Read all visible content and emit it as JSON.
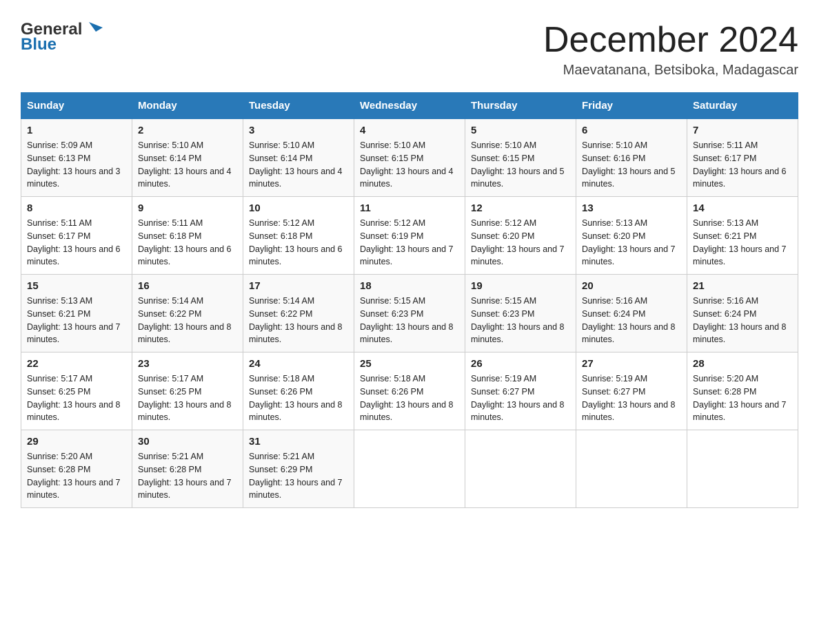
{
  "logo": {
    "text_general": "General",
    "text_blue": "Blue"
  },
  "title": "December 2024",
  "location": "Maevatanana, Betsiboka, Madagascar",
  "days_of_week": [
    "Sunday",
    "Monday",
    "Tuesday",
    "Wednesday",
    "Thursday",
    "Friday",
    "Saturday"
  ],
  "weeks": [
    [
      {
        "day": "1",
        "sunrise": "5:09 AM",
        "sunset": "6:13 PM",
        "daylight": "13 hours and 3 minutes."
      },
      {
        "day": "2",
        "sunrise": "5:10 AM",
        "sunset": "6:14 PM",
        "daylight": "13 hours and 4 minutes."
      },
      {
        "day": "3",
        "sunrise": "5:10 AM",
        "sunset": "6:14 PM",
        "daylight": "13 hours and 4 minutes."
      },
      {
        "day": "4",
        "sunrise": "5:10 AM",
        "sunset": "6:15 PM",
        "daylight": "13 hours and 4 minutes."
      },
      {
        "day": "5",
        "sunrise": "5:10 AM",
        "sunset": "6:15 PM",
        "daylight": "13 hours and 5 minutes."
      },
      {
        "day": "6",
        "sunrise": "5:10 AM",
        "sunset": "6:16 PM",
        "daylight": "13 hours and 5 minutes."
      },
      {
        "day": "7",
        "sunrise": "5:11 AM",
        "sunset": "6:17 PM",
        "daylight": "13 hours and 6 minutes."
      }
    ],
    [
      {
        "day": "8",
        "sunrise": "5:11 AM",
        "sunset": "6:17 PM",
        "daylight": "13 hours and 6 minutes."
      },
      {
        "day": "9",
        "sunrise": "5:11 AM",
        "sunset": "6:18 PM",
        "daylight": "13 hours and 6 minutes."
      },
      {
        "day": "10",
        "sunrise": "5:12 AM",
        "sunset": "6:18 PM",
        "daylight": "13 hours and 6 minutes."
      },
      {
        "day": "11",
        "sunrise": "5:12 AM",
        "sunset": "6:19 PM",
        "daylight": "13 hours and 7 minutes."
      },
      {
        "day": "12",
        "sunrise": "5:12 AM",
        "sunset": "6:20 PM",
        "daylight": "13 hours and 7 minutes."
      },
      {
        "day": "13",
        "sunrise": "5:13 AM",
        "sunset": "6:20 PM",
        "daylight": "13 hours and 7 minutes."
      },
      {
        "day": "14",
        "sunrise": "5:13 AM",
        "sunset": "6:21 PM",
        "daylight": "13 hours and 7 minutes."
      }
    ],
    [
      {
        "day": "15",
        "sunrise": "5:13 AM",
        "sunset": "6:21 PM",
        "daylight": "13 hours and 7 minutes."
      },
      {
        "day": "16",
        "sunrise": "5:14 AM",
        "sunset": "6:22 PM",
        "daylight": "13 hours and 8 minutes."
      },
      {
        "day": "17",
        "sunrise": "5:14 AM",
        "sunset": "6:22 PM",
        "daylight": "13 hours and 8 minutes."
      },
      {
        "day": "18",
        "sunrise": "5:15 AM",
        "sunset": "6:23 PM",
        "daylight": "13 hours and 8 minutes."
      },
      {
        "day": "19",
        "sunrise": "5:15 AM",
        "sunset": "6:23 PM",
        "daylight": "13 hours and 8 minutes."
      },
      {
        "day": "20",
        "sunrise": "5:16 AM",
        "sunset": "6:24 PM",
        "daylight": "13 hours and 8 minutes."
      },
      {
        "day": "21",
        "sunrise": "5:16 AM",
        "sunset": "6:24 PM",
        "daylight": "13 hours and 8 minutes."
      }
    ],
    [
      {
        "day": "22",
        "sunrise": "5:17 AM",
        "sunset": "6:25 PM",
        "daylight": "13 hours and 8 minutes."
      },
      {
        "day": "23",
        "sunrise": "5:17 AM",
        "sunset": "6:25 PM",
        "daylight": "13 hours and 8 minutes."
      },
      {
        "day": "24",
        "sunrise": "5:18 AM",
        "sunset": "6:26 PM",
        "daylight": "13 hours and 8 minutes."
      },
      {
        "day": "25",
        "sunrise": "5:18 AM",
        "sunset": "6:26 PM",
        "daylight": "13 hours and 8 minutes."
      },
      {
        "day": "26",
        "sunrise": "5:19 AM",
        "sunset": "6:27 PM",
        "daylight": "13 hours and 8 minutes."
      },
      {
        "day": "27",
        "sunrise": "5:19 AM",
        "sunset": "6:27 PM",
        "daylight": "13 hours and 8 minutes."
      },
      {
        "day": "28",
        "sunrise": "5:20 AM",
        "sunset": "6:28 PM",
        "daylight": "13 hours and 7 minutes."
      }
    ],
    [
      {
        "day": "29",
        "sunrise": "5:20 AM",
        "sunset": "6:28 PM",
        "daylight": "13 hours and 7 minutes."
      },
      {
        "day": "30",
        "sunrise": "5:21 AM",
        "sunset": "6:28 PM",
        "daylight": "13 hours and 7 minutes."
      },
      {
        "day": "31",
        "sunrise": "5:21 AM",
        "sunset": "6:29 PM",
        "daylight": "13 hours and 7 minutes."
      },
      null,
      null,
      null,
      null
    ]
  ]
}
